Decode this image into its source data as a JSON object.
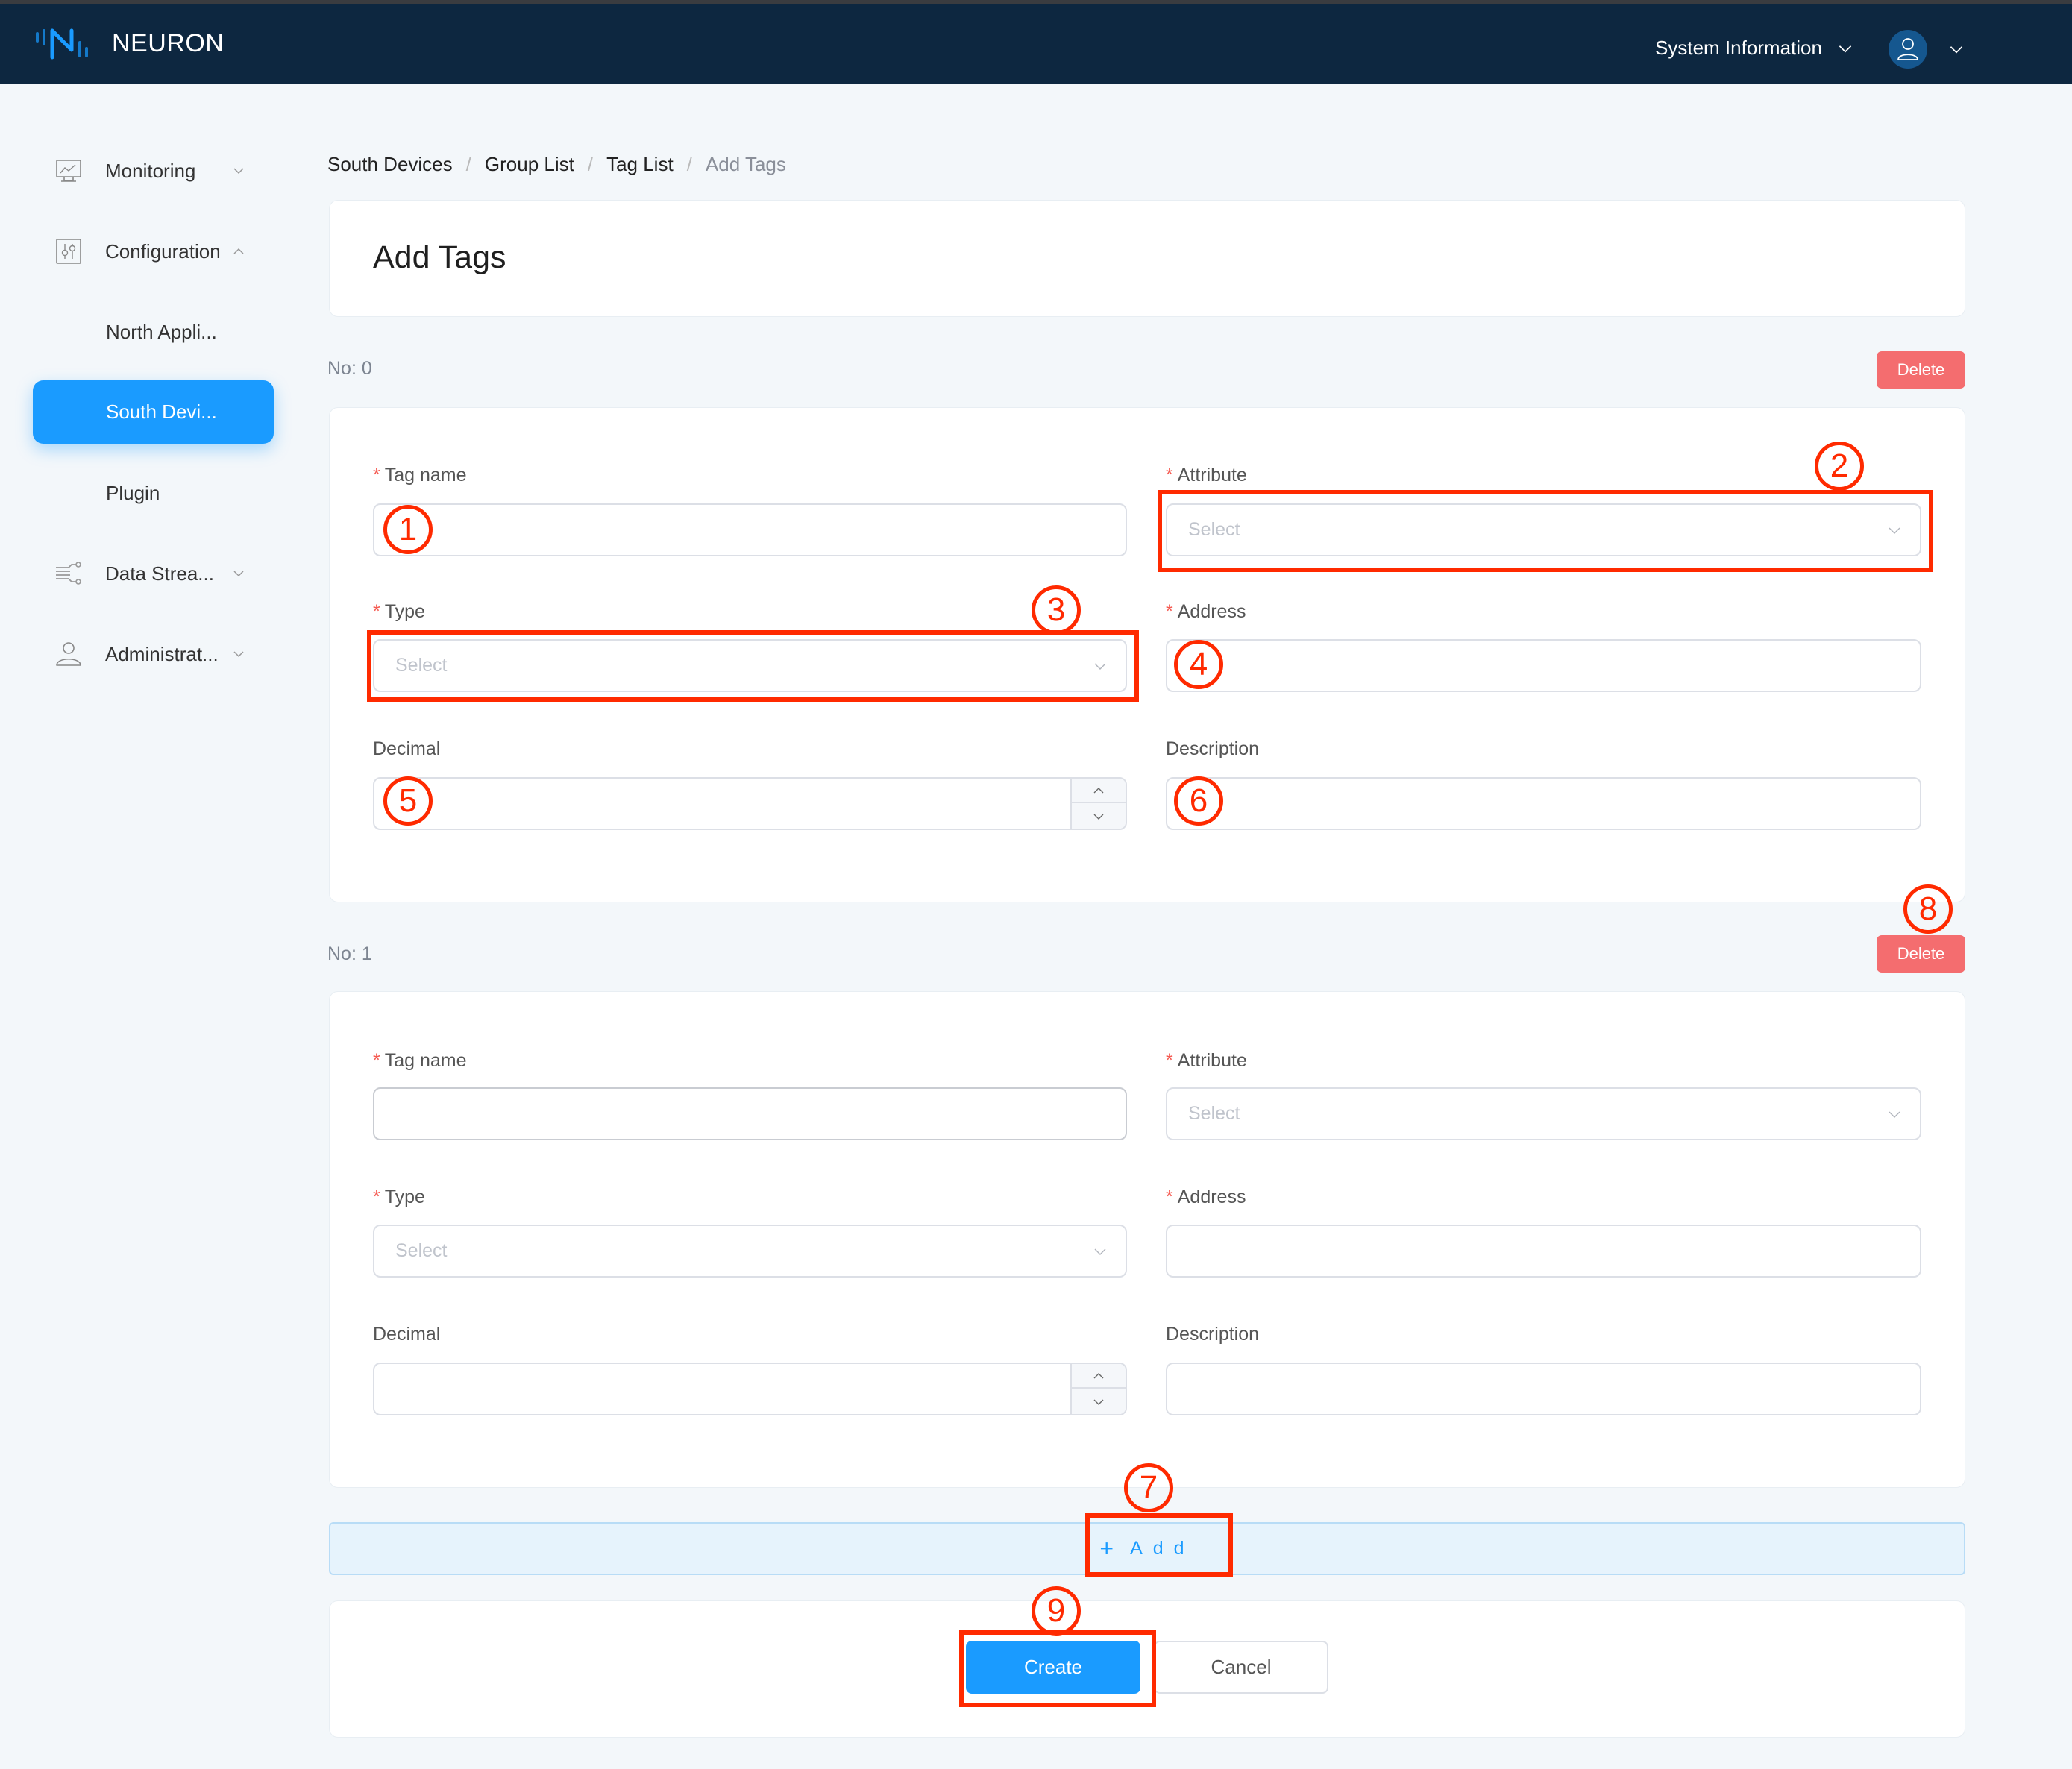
{
  "header": {
    "brand": "NEURON",
    "system_info_label": "System Information",
    "colors": {
      "background": "#0d2740",
      "accent": "#1a9bff"
    }
  },
  "sidebar": {
    "items": [
      {
        "label": "Monitoring",
        "icon": "monitor-chart-icon",
        "expanded": false
      },
      {
        "label": "Configuration",
        "icon": "sliders-icon",
        "expanded": true,
        "children": [
          {
            "label": "North Appli...",
            "active": false
          },
          {
            "label": "South Devi...",
            "active": true
          },
          {
            "label": "Plugin",
            "active": false
          }
        ]
      },
      {
        "label": "Data Strea...",
        "icon": "data-stream-icon",
        "expanded": false
      },
      {
        "label": "Administrat...",
        "icon": "user-icon",
        "expanded": false
      }
    ]
  },
  "breadcrumb": [
    "South Devices",
    "Group List",
    "Tag List",
    "Add Tags"
  ],
  "page_title": "Add Tags",
  "tags": [
    {
      "no_label": "No: 0",
      "delete_label": "Delete",
      "fields": {
        "tag_name": {
          "label": "Tag name",
          "required": true,
          "value": ""
        },
        "attribute": {
          "label": "Attribute",
          "required": true,
          "placeholder": "Select"
        },
        "type": {
          "label": "Type",
          "required": true,
          "placeholder": "Select"
        },
        "address": {
          "label": "Address",
          "required": true,
          "value": ""
        },
        "decimal": {
          "label": "Decimal",
          "required": false,
          "value": ""
        },
        "description": {
          "label": "Description",
          "required": false,
          "value": ""
        }
      }
    },
    {
      "no_label": "No: 1",
      "delete_label": "Delete",
      "fields": {
        "tag_name": {
          "label": "Tag name",
          "required": true,
          "value": ""
        },
        "attribute": {
          "label": "Attribute",
          "required": true,
          "placeholder": "Select"
        },
        "type": {
          "label": "Type",
          "required": true,
          "placeholder": "Select"
        },
        "address": {
          "label": "Address",
          "required": true,
          "value": ""
        },
        "decimal": {
          "label": "Decimal",
          "required": false,
          "value": ""
        },
        "description": {
          "label": "Description",
          "required": false,
          "value": ""
        }
      }
    }
  ],
  "add_label": "Add",
  "actions": {
    "create_label": "Create",
    "cancel_label": "Cancel"
  },
  "required_mark": "*",
  "annotations": [
    "1",
    "2",
    "3",
    "4",
    "5",
    "6",
    "7",
    "8",
    "9"
  ]
}
